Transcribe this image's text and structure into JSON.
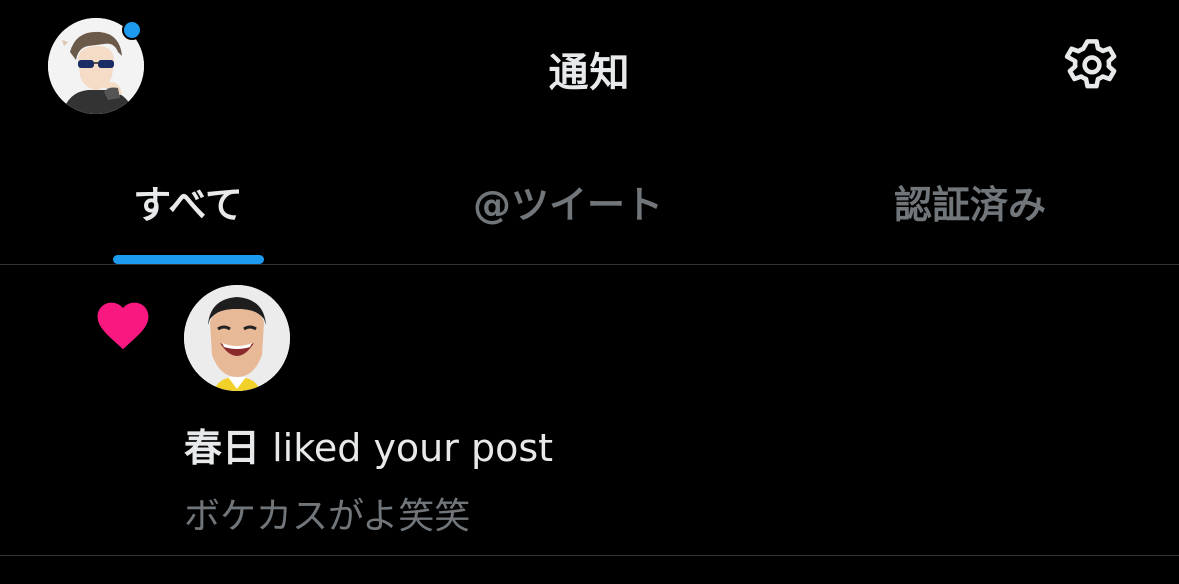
{
  "header": {
    "title": "通知",
    "profile_icon": "user-avatar",
    "settings_icon": "gear-icon",
    "unread_dot_color": "#1d9bf0"
  },
  "tabs": [
    {
      "label": "すべて",
      "active": true
    },
    {
      "label": "@ツイート",
      "active": false
    },
    {
      "label": "認証済み",
      "active": false
    }
  ],
  "notifications": [
    {
      "type": "like",
      "icon": "heart-icon",
      "icon_color": "#f91880",
      "user_name": "春日",
      "action_text": " liked your post",
      "post_preview": "ボケカスがよ笑笑"
    }
  ],
  "colors": {
    "background": "#000000",
    "accent": "#1d9bf0",
    "text_primary": "#e7e9ea",
    "text_secondary": "#71767b",
    "like": "#f91880"
  }
}
